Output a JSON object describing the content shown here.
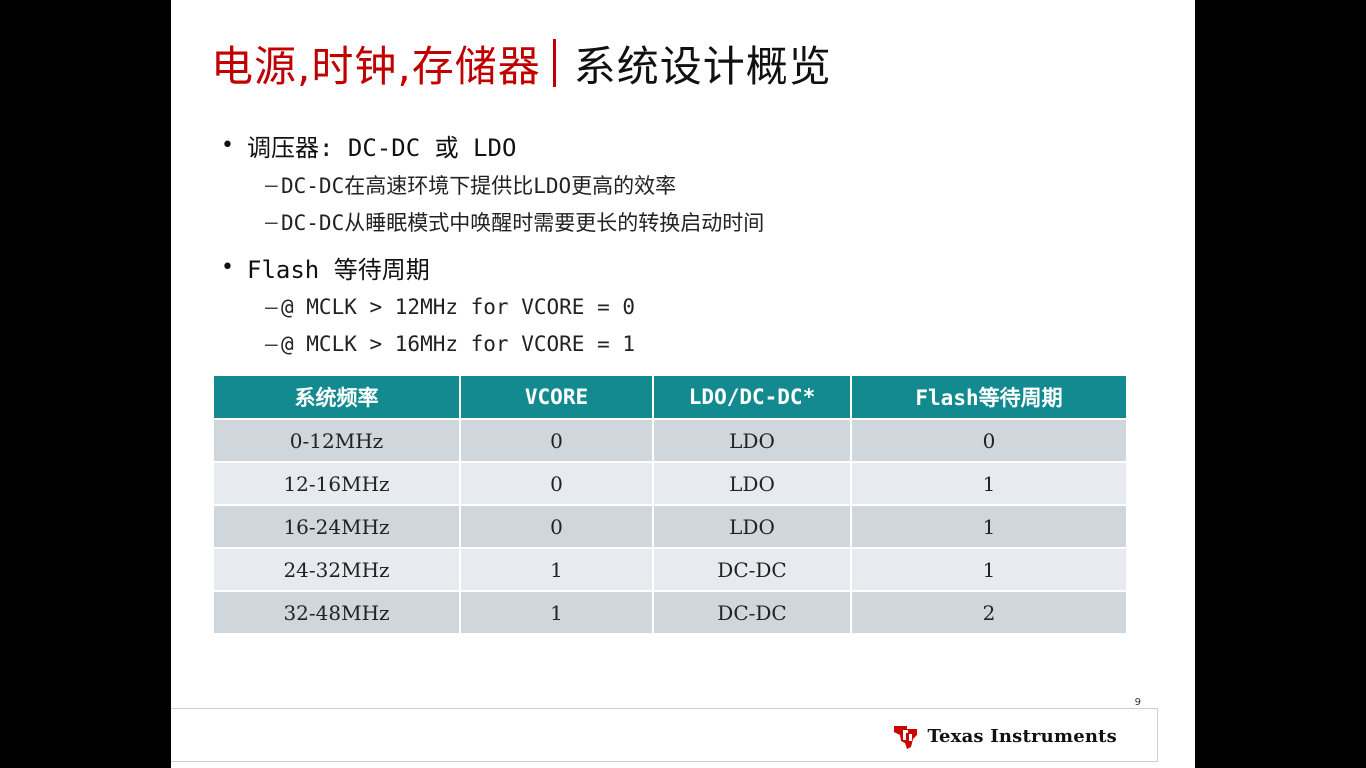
{
  "slide": {
    "title_red": "电源,时钟,存储器",
    "title_black": "系统设计概览",
    "page_number": "9",
    "logo_text": "Texas Instruments"
  },
  "bullets": [
    {
      "text": "调压器: DC-DC 或 LDO",
      "sub": [
        "DC-DC在高速环境下提供比LDO更高的效率",
        "DC-DC从睡眠模式中唤醒时需要更长的转换启动时间"
      ]
    },
    {
      "text": "Flash 等待周期",
      "sub": [
        "@ MCLK > 12MHz for VCORE = 0",
        "@ MCLK > 16MHz for VCORE = 1"
      ]
    }
  ],
  "table": {
    "headers": [
      "系统频率",
      "VCORE",
      "LDO/DC-DC*",
      "Flash等待周期"
    ],
    "rows": [
      [
        "0-12MHz",
        "0",
        "LDO",
        "0"
      ],
      [
        "12-16MHz",
        "0",
        "LDO",
        "1"
      ],
      [
        "16-24MHz",
        "0",
        "LDO",
        "1"
      ],
      [
        "24-32MHz",
        "1",
        "DC-DC",
        "1"
      ],
      [
        "32-48MHz",
        "1",
        "DC-DC",
        "2"
      ]
    ]
  },
  "colors": {
    "title_red": "#c00000",
    "table_header": "#138a8f",
    "row_dark": "#cfd6dc",
    "row_light": "#e7eaee",
    "ti_red": "#cc0000"
  },
  "icons": {
    "logo": "ti-texas-logo-icon"
  }
}
